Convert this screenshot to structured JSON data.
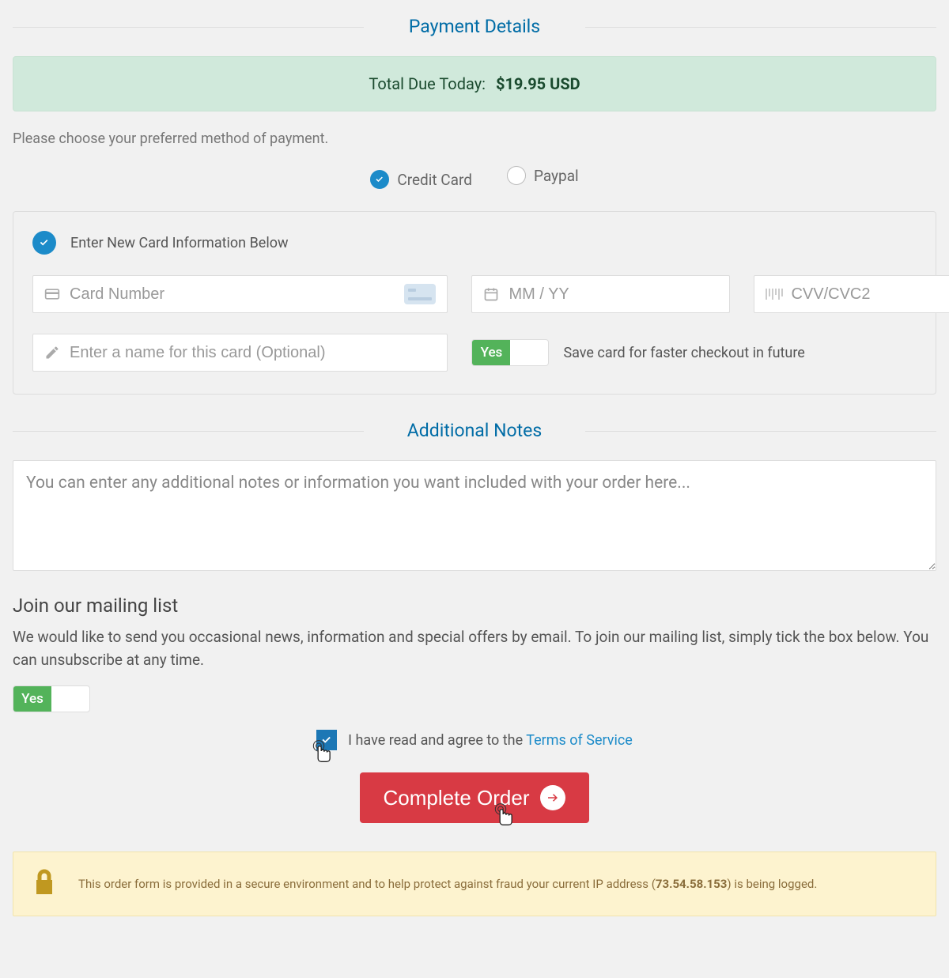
{
  "sections": {
    "payment_details": "Payment Details",
    "additional_notes": "Additional Notes"
  },
  "total": {
    "label": "Total Due Today:",
    "amount": "$19.95 USD"
  },
  "hint": "Please choose your preferred method of payment.",
  "methods": {
    "credit_card": "Credit Card",
    "paypal": "Paypal"
  },
  "card_panel": {
    "heading": "Enter New Card Information Below",
    "card_number_placeholder": "Card Number",
    "expiry_placeholder": "MM / YY",
    "cvv_placeholder": "CVV/CVC2",
    "cvv_help": "?",
    "name_placeholder": "Enter a name for this card (Optional)",
    "toggle_yes": "Yes",
    "save_label": "Save card for faster checkout in future"
  },
  "notes_placeholder": "You can enter any additional notes or information you want included with your order here...",
  "mailing": {
    "heading": "Join our mailing list",
    "text": "We would like to send you occasional news, information and special offers by email. To join our mailing list, simply tick the box below. You can unsubscribe at any time.",
    "toggle_yes": "Yes"
  },
  "tos": {
    "prefix": "I have read and agree to the ",
    "link": "Terms of Service"
  },
  "complete_label": "Complete Order",
  "secure": {
    "prefix": "This order form is provided in a secure environment and to help protect against fraud your current IP address (",
    "ip": "73.54.58.153",
    "suffix": ") is being logged."
  }
}
